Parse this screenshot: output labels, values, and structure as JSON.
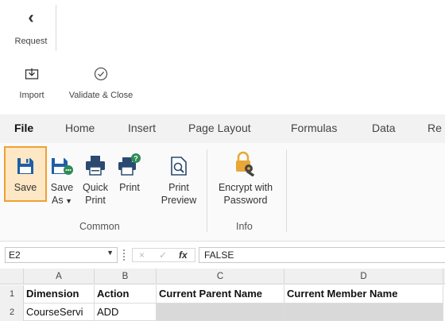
{
  "toolbar": {
    "request_label": "Request",
    "import_label": "Import",
    "validate_label": "Validate & Close"
  },
  "ribbon_tabs": [
    "File",
    "Home",
    "Insert",
    "Page Layout",
    "Formulas",
    "Data",
    "Re"
  ],
  "ribbon": {
    "save": "Save",
    "save_as_1": "Save",
    "save_as_2": "As",
    "quick_print_1": "Quick",
    "quick_print_2": "Print",
    "print": "Print",
    "print_preview_1": "Print",
    "print_preview_2": "Preview",
    "encrypt_1": "Encrypt with",
    "encrypt_2": "Password",
    "group_common": "Common",
    "group_info": "Info"
  },
  "formula_bar": {
    "name_box": "E2",
    "value": "FALSE",
    "cancel_symbol": "×",
    "enter_symbol": "✓",
    "fx_symbol": "fx"
  },
  "sheet": {
    "columns": [
      "A",
      "B",
      "C",
      "D"
    ],
    "row_numbers": [
      "1",
      "2"
    ],
    "row1": [
      "Dimension",
      "Action",
      "Current Parent Name",
      "Current Member Name"
    ],
    "row2": [
      "CourseServi",
      "ADD"
    ]
  },
  "colors": {
    "accent_blue": "#1f5fa8",
    "highlight_orange": "#f0a030",
    "lock_gold": "#e8a838"
  }
}
